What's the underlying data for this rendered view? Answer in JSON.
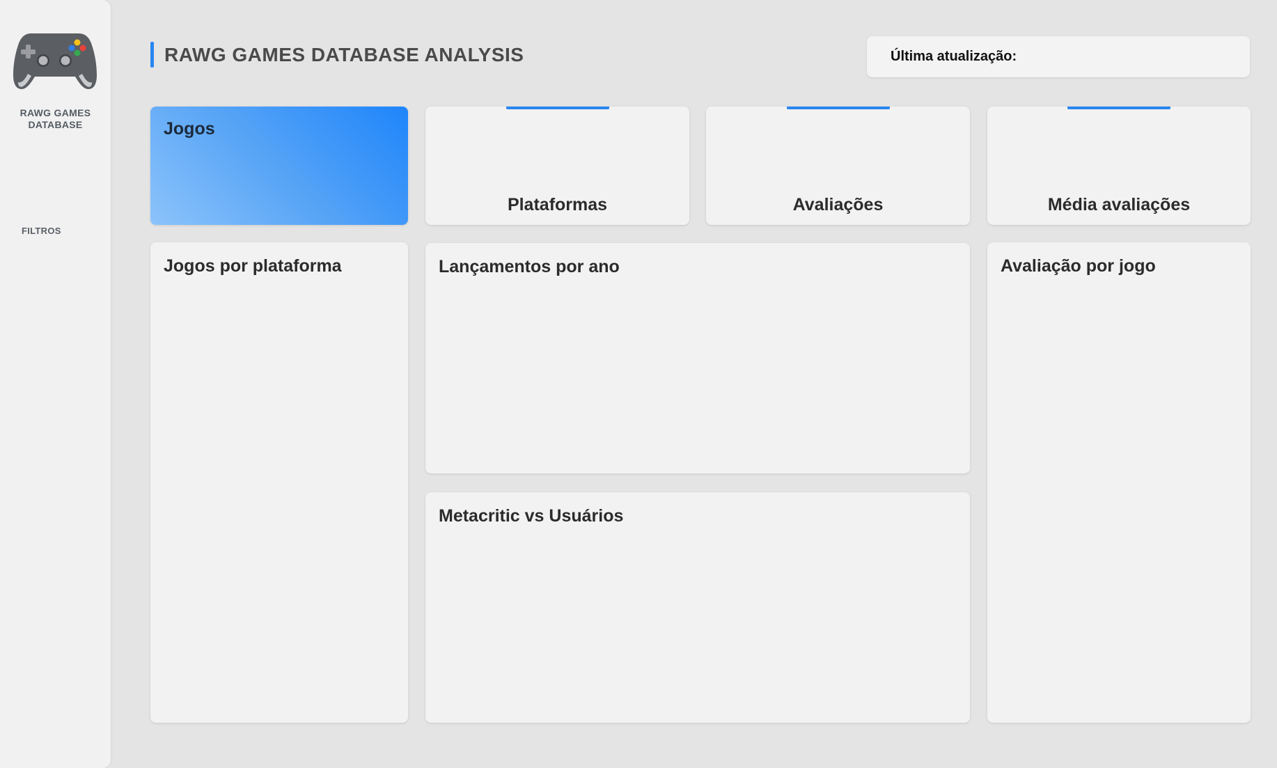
{
  "sidebar": {
    "logo_icon": "gamepad-icon",
    "brand_name": "RAWG GAMES\nDATABASE",
    "filters_label": "FILTROS"
  },
  "header": {
    "title": "RAWG GAMES DATABASE ANALYSIS",
    "update_label": "Última atualização:",
    "update_value": ""
  },
  "kpis": [
    {
      "label": "Jogos",
      "value": ""
    },
    {
      "label": "Plataformas",
      "value": ""
    },
    {
      "label": "Avaliações",
      "value": ""
    },
    {
      "label": "Média avaliações",
      "value": ""
    }
  ],
  "panels": {
    "games_by_platform": "Jogos por plataforma",
    "releases_by_year": "Lançamentos por ano",
    "metacritic_vs_users": "Metacritic vs Usuários",
    "rating_by_game": "Avaliação por jogo"
  },
  "colors": {
    "accent": "#2a86f0",
    "highlight_start": "#1f85fa",
    "highlight_end": "#8cc3fb",
    "background": "#e4e4e4",
    "card": "#f2f2f2"
  }
}
